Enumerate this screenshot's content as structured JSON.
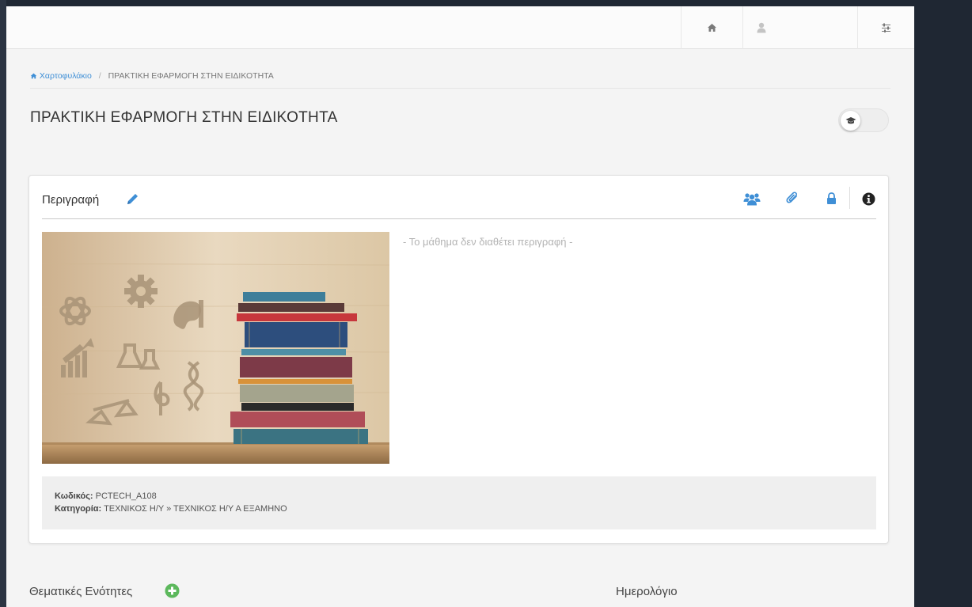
{
  "topbar": {
    "icons": [
      "home-icon",
      "user-icon",
      "sliders-icon"
    ]
  },
  "breadcrumb": {
    "home_label": "Χαρτοφυλάκιο",
    "separator": "/",
    "current": "ΠΡΑΚΤΙΚΗ ΕΦΑΡΜΟΓΗ ΣΤΗΝ ΕΙΔΙΚΟΤΗΤΑ"
  },
  "page": {
    "title": "ΠΡΑΚΤΙΚΗ ΕΦΑΡΜΟΓΗ ΣΤΗΝ ΕΙΔΙΚΟΤΗΤΑ",
    "toggle_icon": "graduation-cap-icon"
  },
  "panel": {
    "title": "Περιγραφή",
    "header_icons": [
      "users-icon",
      "paperclip-icon",
      "lock-icon",
      "info-icon"
    ],
    "no_description": "- Το μάθημα δεν διαθέτει περιγραφή -",
    "code_label": "Κωδικός:",
    "code_value": "PCTECH_A108",
    "category_label": "Κατηγορία:",
    "category_value": "ΤΕΧΝΙΚΟΣ Η/Υ » ΤΕΧΝΙΚΟΣ Η/Υ Α ΕΞΑΜΗΝΟ"
  },
  "sections": {
    "units_title": "Θεματικές Ενότητες",
    "calendar_title": "Ημερολόγιο"
  },
  "colors": {
    "accent": "#3f8fd6",
    "add_green": "#5cb85c",
    "dark_bg": "#1f2733"
  }
}
